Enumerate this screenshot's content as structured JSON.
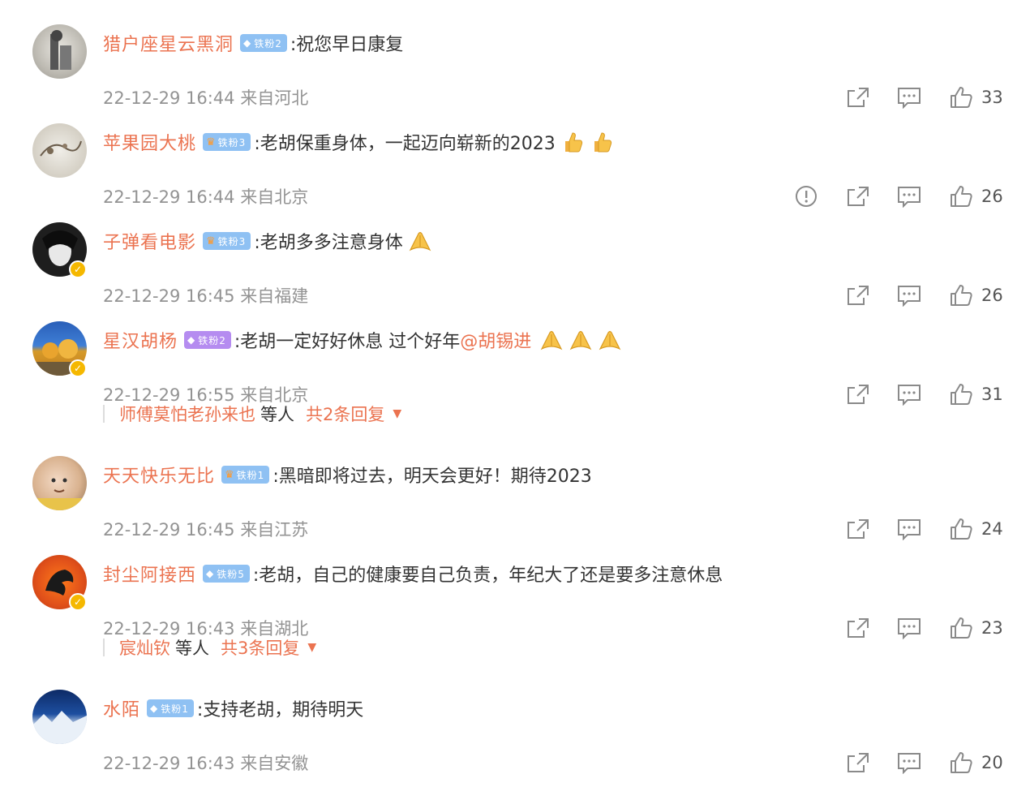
{
  "comments": [
    {
      "user": "猎户座星云黑洞",
      "badge": "铁粉2",
      "text": ":祝您早日康复",
      "time": "22-12-29 16:44 来自河北",
      "likes": "33"
    },
    {
      "user": "苹果园大桃",
      "badge": "铁粉3",
      "text": ":老胡保重身体，一起迈向崭新的2023",
      "time": "22-12-29 16:44 来自北京",
      "likes": "26"
    },
    {
      "user": "子弹看电影",
      "badge": "铁粉3",
      "text": ":老胡多多注意身体",
      "time": "22-12-29 16:45 来自福建",
      "likes": "26"
    },
    {
      "user": "星汉胡杨",
      "badge": "铁粉2",
      "text": ":老胡一定好好休息 过个好年",
      "mention": "@胡锡进",
      "time": "22-12-29 16:55 来自北京",
      "likes": "31",
      "replies": {
        "name": "师傅莫怕老孙来也",
        "etc": "等人",
        "total": "共2条回复"
      }
    },
    {
      "user": "天天快乐无比",
      "badge": "铁粉1",
      "text": ":黑暗即将过去，明天会更好！期待2023",
      "time": "22-12-29 16:45 来自江苏",
      "likes": "24"
    },
    {
      "user": "封尘阿接西",
      "badge": "铁粉5",
      "text": ":老胡，自己的健康要自己负责，年纪大了还是要多注意休息",
      "time": "22-12-29 16:43 来自湖北",
      "likes": "23",
      "replies": {
        "name": "宸灿钦",
        "etc": "等人",
        "total": "共3条回复"
      }
    },
    {
      "user": "水陌",
      "badge": "铁粉1",
      "text": ":支持老胡，期待明天",
      "time": "22-12-29 16:43 来自安徽",
      "likes": "20"
    }
  ],
  "colors": {
    "username": "#eb7350",
    "meta": "#939393",
    "icon": "#8a8a8a"
  },
  "icons": [
    "share-icon",
    "comment-icon",
    "like-icon",
    "report-icon",
    "verified-icon",
    "thumbs-up-emoji",
    "pray-hands-emoji"
  ]
}
